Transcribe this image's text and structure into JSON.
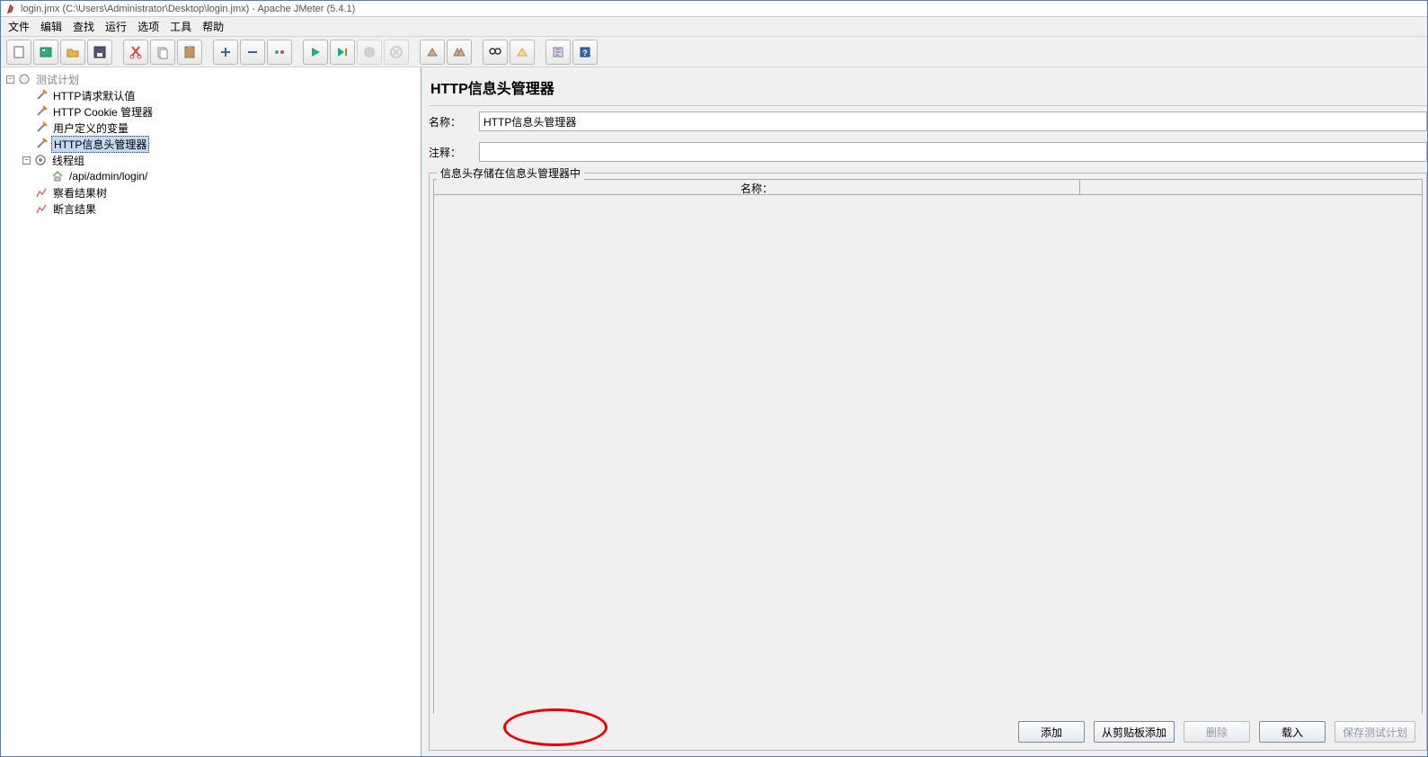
{
  "titlebar": "login.jmx (C:\\Users\\Administrator\\Desktop\\login.jmx) - Apache JMeter (5.4.1)",
  "menu": {
    "file": "文件",
    "edit": "编辑",
    "search": "查找",
    "run": "运行",
    "options": "选项",
    "tools": "工具",
    "help": "帮助"
  },
  "tree": {
    "root": "测试计划",
    "http_req_defaults": "HTTP请求默认值",
    "http_cookie_mgr": "HTTP Cookie 管理器",
    "user_vars": "用户定义的变量",
    "http_header_mgr": "HTTP信息头管理器",
    "thread_group": "线程组",
    "api_login": "/api/admin/login/",
    "result_tree": "察看结果树",
    "assert_result": "断言结果"
  },
  "panel": {
    "title": "HTTP信息头管理器",
    "name_label": "名称：",
    "name_value": "HTTP信息头管理器",
    "comment_label": "注释：",
    "comment_value": "",
    "group_title": "信息头存储在信息头管理器中",
    "col_name": "名称：",
    "col_value": ""
  },
  "buttons": {
    "add": "添加",
    "paste": "从剪贴板添加",
    "delete": "删除",
    "load": "载入",
    "save": "保存测试计划"
  }
}
